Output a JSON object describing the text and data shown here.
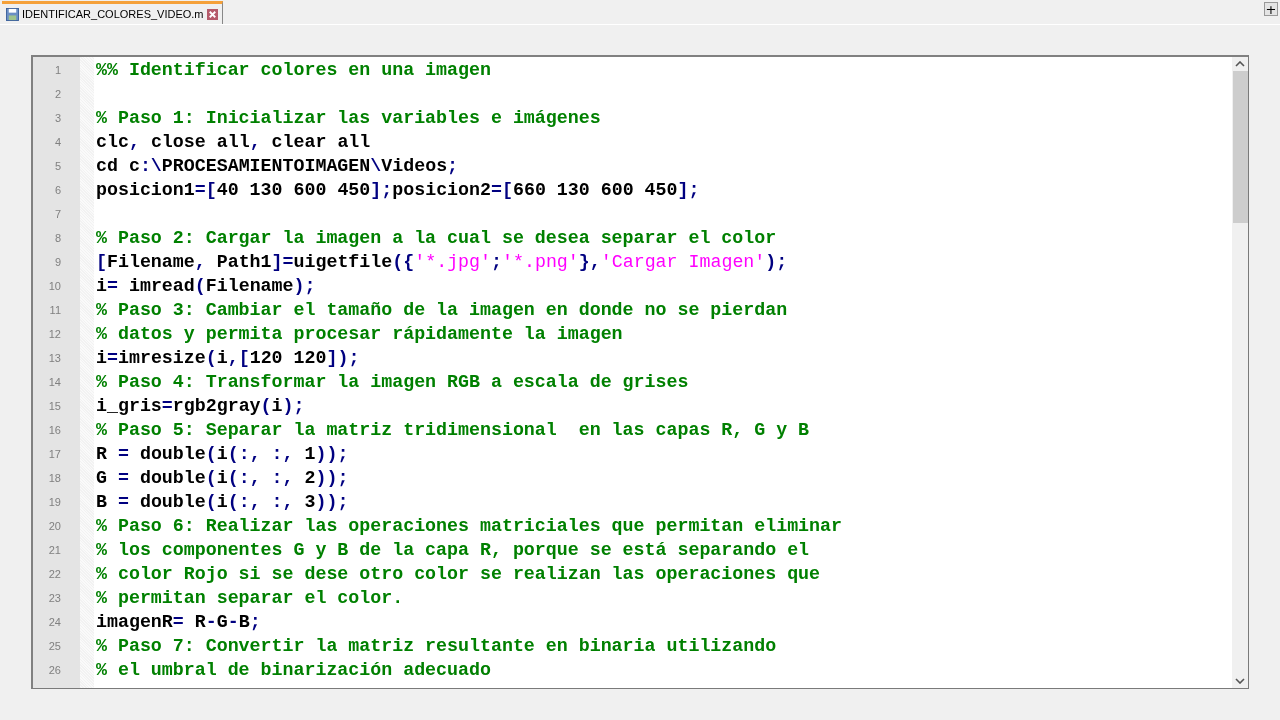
{
  "tabs": [
    {
      "label": "IDENTIFICAR_COLORES_VIDEO.m",
      "selected": true
    }
  ],
  "new_tab_button": "+",
  "editor": {
    "lines": [
      {
        "number": "1",
        "segments": [
          {
            "kind": "comment",
            "text": "%% Identificar colores en una imagen"
          }
        ]
      },
      {
        "number": "2"
      },
      {
        "number": "3",
        "segments": [
          {
            "kind": "comment",
            "text": "% Paso 1: Inicializar las variables e imágenes"
          }
        ]
      },
      {
        "number": "4",
        "segments": [
          {
            "kind": "code",
            "text": "clc"
          },
          {
            "kind": "op",
            "text": ","
          },
          {
            "kind": "code",
            "text": " close all"
          },
          {
            "kind": "op",
            "text": ","
          },
          {
            "kind": "code",
            "text": " clear all"
          }
        ]
      },
      {
        "number": "5",
        "segments": [
          {
            "kind": "code",
            "text": "cd c"
          },
          {
            "kind": "op",
            "text": ":\\"
          },
          {
            "kind": "code",
            "text": "PROCESAMIENTOIMAGEN"
          },
          {
            "kind": "op",
            "text": "\\"
          },
          {
            "kind": "code",
            "text": "Videos"
          },
          {
            "kind": "op",
            "text": ";"
          }
        ]
      },
      {
        "number": "6",
        "segments": [
          {
            "kind": "code",
            "text": "posicion1"
          },
          {
            "kind": "op",
            "text": "=["
          },
          {
            "kind": "code",
            "text": "40 130 600 450"
          },
          {
            "kind": "op",
            "text": "];"
          },
          {
            "kind": "code",
            "text": "posicion2"
          },
          {
            "kind": "op",
            "text": "=["
          },
          {
            "kind": "code",
            "text": "660 130 600 450"
          },
          {
            "kind": "op",
            "text": "];"
          }
        ]
      },
      {
        "number": "7"
      },
      {
        "number": "8",
        "segments": [
          {
            "kind": "comment",
            "text": "% Paso 2: Cargar la imagen a la cual se desea separar el color"
          }
        ]
      },
      {
        "number": "9",
        "segments": [
          {
            "kind": "op",
            "text": "["
          },
          {
            "kind": "code",
            "text": "Filename"
          },
          {
            "kind": "op",
            "text": ","
          },
          {
            "kind": "code",
            "text": " Path1"
          },
          {
            "kind": "op",
            "text": "]="
          },
          {
            "kind": "code",
            "text": "uigetfile"
          },
          {
            "kind": "op",
            "text": "({"
          },
          {
            "kind": "string",
            "text": "'*.jpg'"
          },
          {
            "kind": "op",
            "text": ";"
          },
          {
            "kind": "string",
            "text": "'*.png'"
          },
          {
            "kind": "op",
            "text": "},"
          },
          {
            "kind": "string",
            "text": "'Cargar Imagen'"
          },
          {
            "kind": "op",
            "text": ");"
          }
        ]
      },
      {
        "number": "10",
        "segments": [
          {
            "kind": "code",
            "text": "i"
          },
          {
            "kind": "op",
            "text": "="
          },
          {
            "kind": "code",
            "text": " imread"
          },
          {
            "kind": "op",
            "text": "("
          },
          {
            "kind": "code",
            "text": "Filename"
          },
          {
            "kind": "op",
            "text": ");"
          }
        ]
      },
      {
        "number": "11",
        "segments": [
          {
            "kind": "comment",
            "text": "% Paso 3: Cambiar el tamaño de la imagen en donde no se pierdan"
          }
        ]
      },
      {
        "number": "12",
        "segments": [
          {
            "kind": "comment",
            "text": "% datos y permita procesar rápidamente la imagen"
          }
        ]
      },
      {
        "number": "13",
        "segments": [
          {
            "kind": "code",
            "text": "i"
          },
          {
            "kind": "op",
            "text": "="
          },
          {
            "kind": "code",
            "text": "imresize"
          },
          {
            "kind": "op",
            "text": "("
          },
          {
            "kind": "code",
            "text": "i"
          },
          {
            "kind": "op",
            "text": ",["
          },
          {
            "kind": "code",
            "text": "120 120"
          },
          {
            "kind": "op",
            "text": "]);"
          }
        ]
      },
      {
        "number": "14",
        "segments": [
          {
            "kind": "comment",
            "text": "% Paso 4: Transformar la imagen RGB a escala de grises"
          }
        ]
      },
      {
        "number": "15",
        "segments": [
          {
            "kind": "code",
            "text": "i_gris"
          },
          {
            "kind": "op",
            "text": "="
          },
          {
            "kind": "code",
            "text": "rgb2gray"
          },
          {
            "kind": "op",
            "text": "("
          },
          {
            "kind": "code",
            "text": "i"
          },
          {
            "kind": "op",
            "text": ");"
          }
        ]
      },
      {
        "number": "16",
        "segments": [
          {
            "kind": "comment",
            "text": "% Paso 5: Separar la matriz tridimensional  en las capas R, G y B"
          }
        ]
      },
      {
        "number": "17",
        "segments": [
          {
            "kind": "code",
            "text": "R "
          },
          {
            "kind": "op",
            "text": "="
          },
          {
            "kind": "code",
            "text": " double"
          },
          {
            "kind": "op",
            "text": "("
          },
          {
            "kind": "code",
            "text": "i"
          },
          {
            "kind": "op",
            "text": "(:, :,"
          },
          {
            "kind": "code",
            "text": " 1"
          },
          {
            "kind": "op",
            "text": "));"
          }
        ]
      },
      {
        "number": "18",
        "segments": [
          {
            "kind": "code",
            "text": "G "
          },
          {
            "kind": "op",
            "text": "="
          },
          {
            "kind": "code",
            "text": " double"
          },
          {
            "kind": "op",
            "text": "("
          },
          {
            "kind": "code",
            "text": "i"
          },
          {
            "kind": "op",
            "text": "(:, :,"
          },
          {
            "kind": "code",
            "text": " 2"
          },
          {
            "kind": "op",
            "text": "));"
          }
        ]
      },
      {
        "number": "19",
        "segments": [
          {
            "kind": "code",
            "text": "B "
          },
          {
            "kind": "op",
            "text": "="
          },
          {
            "kind": "code",
            "text": " double"
          },
          {
            "kind": "op",
            "text": "("
          },
          {
            "kind": "code",
            "text": "i"
          },
          {
            "kind": "op",
            "text": "(:, :,"
          },
          {
            "kind": "code",
            "text": " 3"
          },
          {
            "kind": "op",
            "text": "));"
          }
        ]
      },
      {
        "number": "20",
        "segments": [
          {
            "kind": "comment",
            "text": "% Paso 6: Realizar las operaciones matriciales que permitan eliminar"
          }
        ]
      },
      {
        "number": "21",
        "segments": [
          {
            "kind": "comment",
            "text": "% los componentes G y B de la capa R, porque se está separando el"
          }
        ]
      },
      {
        "number": "22",
        "segments": [
          {
            "kind": "comment",
            "text": "% color Rojo si se dese otro color se realizan las operaciones que"
          }
        ]
      },
      {
        "number": "23",
        "segments": [
          {
            "kind": "comment",
            "text": "% permitan separar el color."
          }
        ]
      },
      {
        "number": "24",
        "segments": [
          {
            "kind": "code",
            "text": "imagenR"
          },
          {
            "kind": "op",
            "text": "="
          },
          {
            "kind": "code",
            "text": " R"
          },
          {
            "kind": "op",
            "text": "-"
          },
          {
            "kind": "code",
            "text": "G"
          },
          {
            "kind": "op",
            "text": "-"
          },
          {
            "kind": "code",
            "text": "B"
          },
          {
            "kind": "op",
            "text": ";"
          }
        ]
      },
      {
        "number": "25",
        "segments": [
          {
            "kind": "comment",
            "text": "% Paso 7: Convertir la matriz resultante en binaria utilizando"
          }
        ]
      },
      {
        "number": "26",
        "segments": [
          {
            "kind": "comment",
            "text": "% el umbral de binarización adecuado"
          }
        ]
      }
    ]
  }
}
